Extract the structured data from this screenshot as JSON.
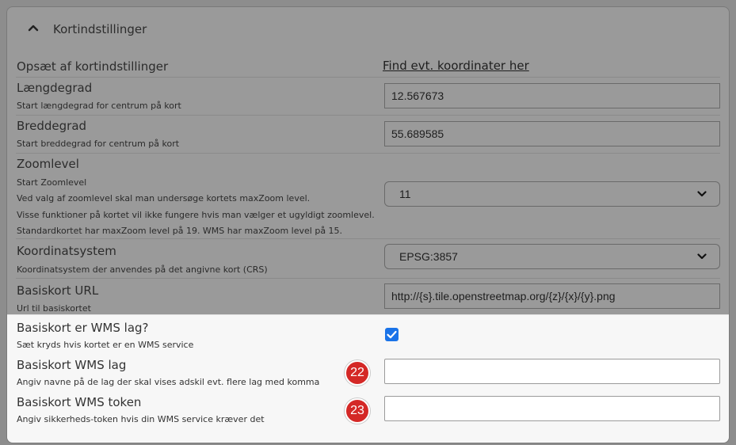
{
  "section": {
    "title": "Kortindstillinger",
    "collapse_icon": "chevron-up-icon"
  },
  "setup": {
    "label": "Opsæt af kortindstillinger",
    "link": "Find evt. koordinater her"
  },
  "longitude": {
    "label": "Længdegrad",
    "help": "Start længdegrad for centrum på kort",
    "value": "12.567673"
  },
  "latitude": {
    "label": "Breddegrad",
    "help": "Start breddegrad for centrum på kort",
    "value": "55.689585"
  },
  "zoom": {
    "label": "Zoomlevel",
    "help1": "Start Zoomlevel",
    "help2": "Ved valg af zoomlevel skal man undersøge kortets maxZoom level.",
    "help3": "Visse funktioner på kortet vil ikke fungere hvis man vælger et ugyldigt zoomlevel.",
    "help4": "Standardkortet har maxZoom level på 19. WMS har maxZoom level på 15.",
    "selected": "11"
  },
  "crs": {
    "label": "Koordinatsystem",
    "help": "Koordinatsystem der anvendes på det angivne kort (CRS)",
    "selected": "EPSG:3857"
  },
  "basemap_url": {
    "label": "Basiskort URL",
    "help": "Url til basiskortet",
    "value": "http://{s}.tile.openstreetmap.org/{z}/{x}/{y}.png"
  },
  "wms_toggle": {
    "label": "Basiskort er WMS lag?",
    "help": "Sæt kryds hvis kortet er en WMS service",
    "checked": true
  },
  "wms_layers": {
    "label": "Basiskort WMS lag",
    "help": "Angiv navne på de lag der skal vises adskil evt. flere lag med komma",
    "value": "",
    "badge": "22"
  },
  "wms_token": {
    "label": "Basiskort WMS token",
    "help": "Angiv sikkerheds-token hvis din WMS service kræver det",
    "value": "",
    "badge": "23"
  },
  "colors": {
    "checkbox": "#1a73e8",
    "badge": "#d42826",
    "overlay": "#8d8d8d"
  }
}
